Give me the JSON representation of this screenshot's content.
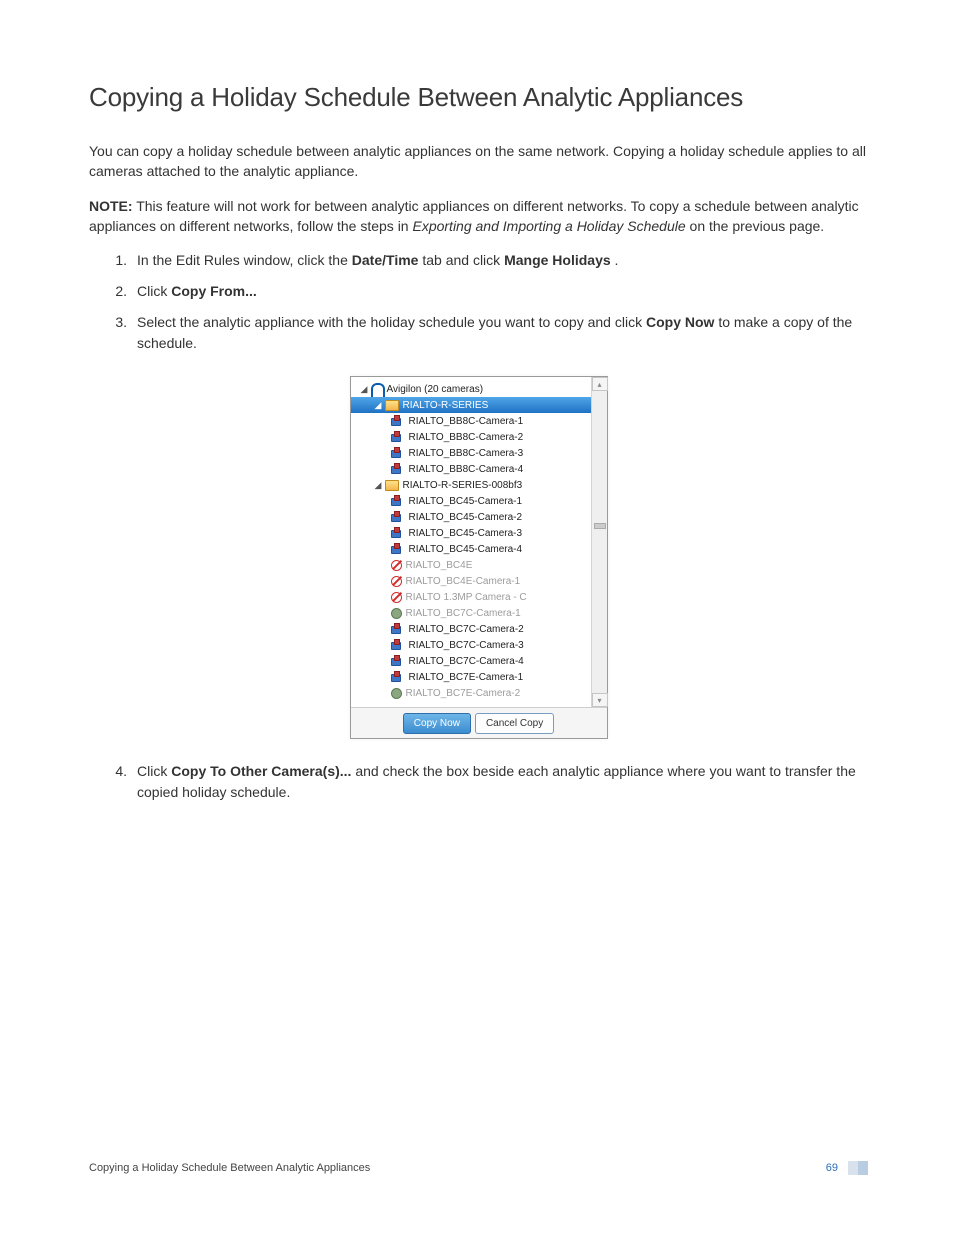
{
  "heading": "Copying a Holiday Schedule Between Analytic Appliances",
  "intro": "You can copy a holiday schedule between analytic appliances on the same network. Copying a holiday schedule applies to all cameras attached to the analytic appliance.",
  "note_label": "NOTE:",
  "note_text_a": "This feature will not work for between analytic appliances on different networks. To copy a schedule between analytic appliances on different networks, follow the steps in ",
  "note_em": "Exporting and Importing a Holiday Schedule",
  "note_text_b": " on the previous page.",
  "steps": {
    "s1": {
      "num": "1.",
      "a": "In the Edit Rules window, click the ",
      "b": "Date/Time",
      "c": " tab and click ",
      "d": "Mange Holidays",
      "e": "."
    },
    "s2": {
      "num": "2.",
      "a": "Click ",
      "b": "Copy From...",
      "c": ""
    },
    "s3": {
      "num": "3.",
      "a": "Select the analytic appliance with the holiday schedule you want to copy and click ",
      "b": "Copy Now",
      "c": " to make a copy of the schedule."
    },
    "s4": {
      "num": "4.",
      "a": "Click ",
      "b": "Copy To Other Camera(s)...",
      "c": " and check the box beside each analytic appliance where you want to transfer the copied holiday schedule."
    }
  },
  "tree": {
    "root": "Avigilon  (20 cameras)",
    "group1": "RIALTO-R-SERIES",
    "g1": [
      "RIALTO_BB8C-Camera-1",
      "RIALTO_BB8C-Camera-2",
      "RIALTO_BB8C-Camera-3",
      "RIALTO_BB8C-Camera-4"
    ],
    "group2": "RIALTO-R-SERIES-008bf3",
    "g2": [
      {
        "name": "RIALTO_BC45-Camera-1",
        "icon": "cam"
      },
      {
        "name": "RIALTO_BC45-Camera-2",
        "icon": "cam"
      },
      {
        "name": "RIALTO_BC45-Camera-3",
        "icon": "cam"
      },
      {
        "name": "RIALTO_BC45-Camera-4",
        "icon": "cam"
      },
      {
        "name": "RIALTO_BC4E",
        "icon": "no",
        "dim": true
      },
      {
        "name": "RIALTO_BC4E-Camera-1",
        "icon": "no",
        "dim": true
      },
      {
        "name": "RIALTO 1.3MP Camera - C",
        "icon": "no",
        "dim": true
      },
      {
        "name": "RIALTO_BC7C-Camera-1",
        "icon": "dot",
        "dim": true
      },
      {
        "name": "RIALTO_BC7C-Camera-2",
        "icon": "cam"
      },
      {
        "name": "RIALTO_BC7C-Camera-3",
        "icon": "cam"
      },
      {
        "name": "RIALTO_BC7C-Camera-4",
        "icon": "cam"
      },
      {
        "name": "RIALTO_BC7E-Camera-1",
        "icon": "cam"
      },
      {
        "name": "RIALTO_BC7E-Camera-2",
        "icon": "dot",
        "dim": true
      }
    ]
  },
  "buttons": {
    "copy": "Copy Now",
    "cancel": "Cancel Copy"
  },
  "footer": {
    "text": "Copying a Holiday Schedule Between Analytic Appliances",
    "page": "69"
  }
}
